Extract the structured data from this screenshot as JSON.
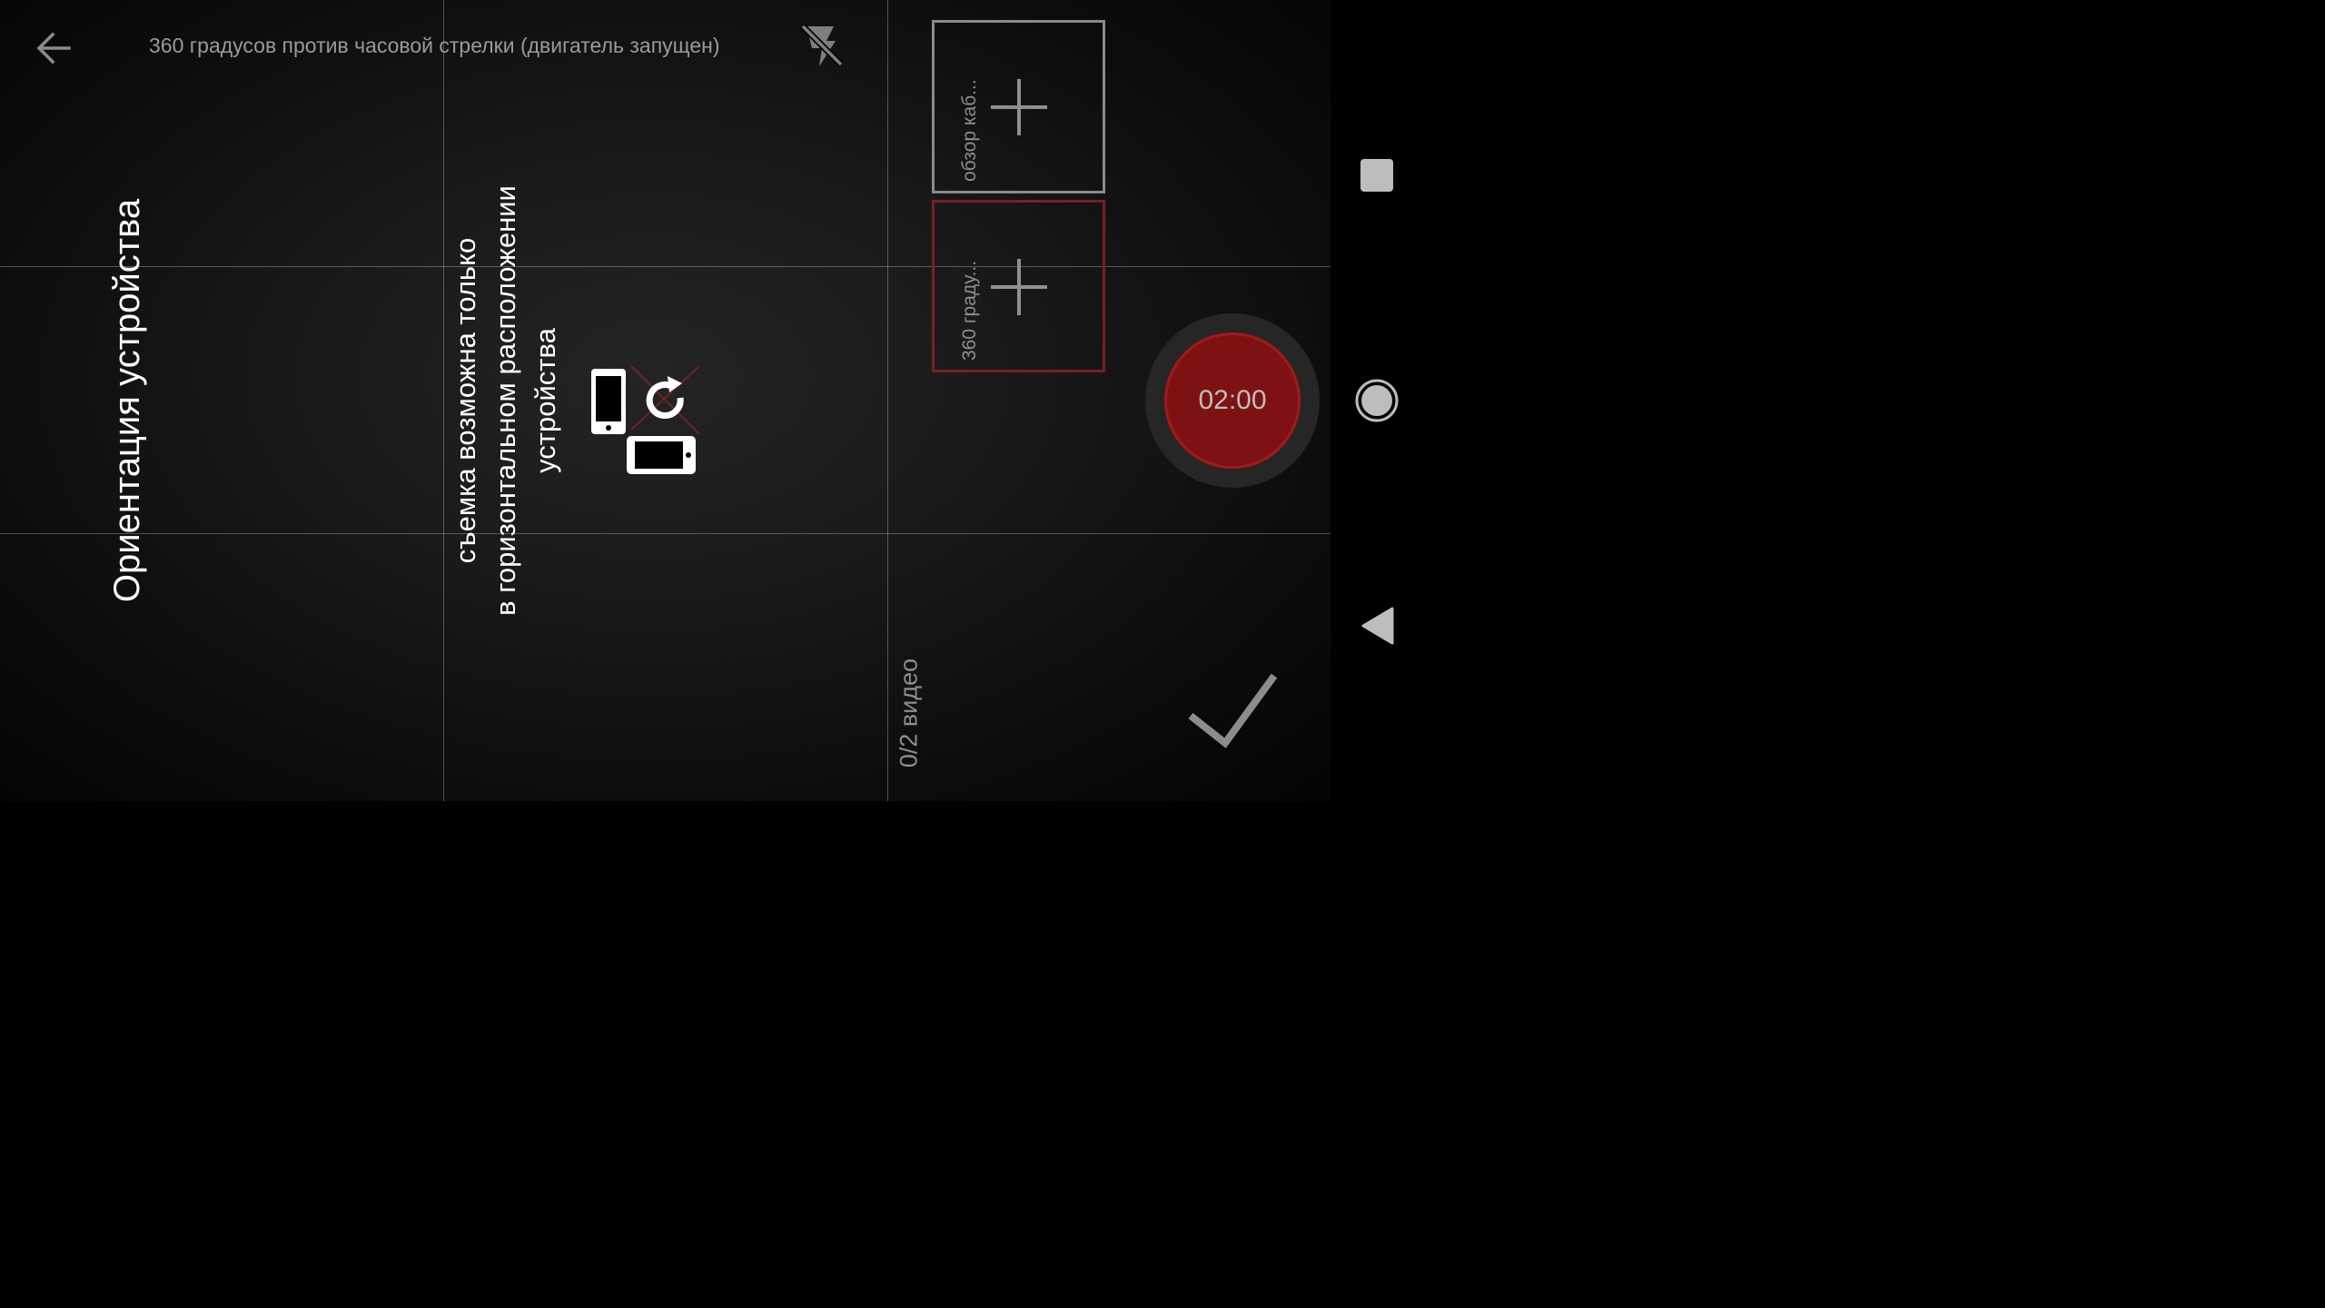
{
  "header": {
    "title": "360 градусов против часовой стрелки (двигатель запущен)",
    "back_icon": "arrow-left-icon",
    "flash_icon": "flash-off-icon"
  },
  "overlay": {
    "orientation_title": "Ориентация устройства",
    "orientation_hint_lines": [
      "съемка возможна только",
      "в горизонтальном расположении",
      "устройства"
    ],
    "hint_icon": "rotate-to-landscape-icon"
  },
  "clips": [
    {
      "label": "обзор каб...",
      "add_icon": "plus-icon"
    },
    {
      "label": "360 граду...",
      "add_icon": "plus-icon"
    }
  ],
  "record": {
    "timer": "02:00",
    "accent_color": "#7e1212"
  },
  "footer": {
    "video_count": "0/2 видео",
    "confirm_icon": "checkmark-icon"
  },
  "system_nav": {
    "recents_icon": "square-icon",
    "home_icon": "circle-icon",
    "back_icon": "triangle-back-icon"
  }
}
